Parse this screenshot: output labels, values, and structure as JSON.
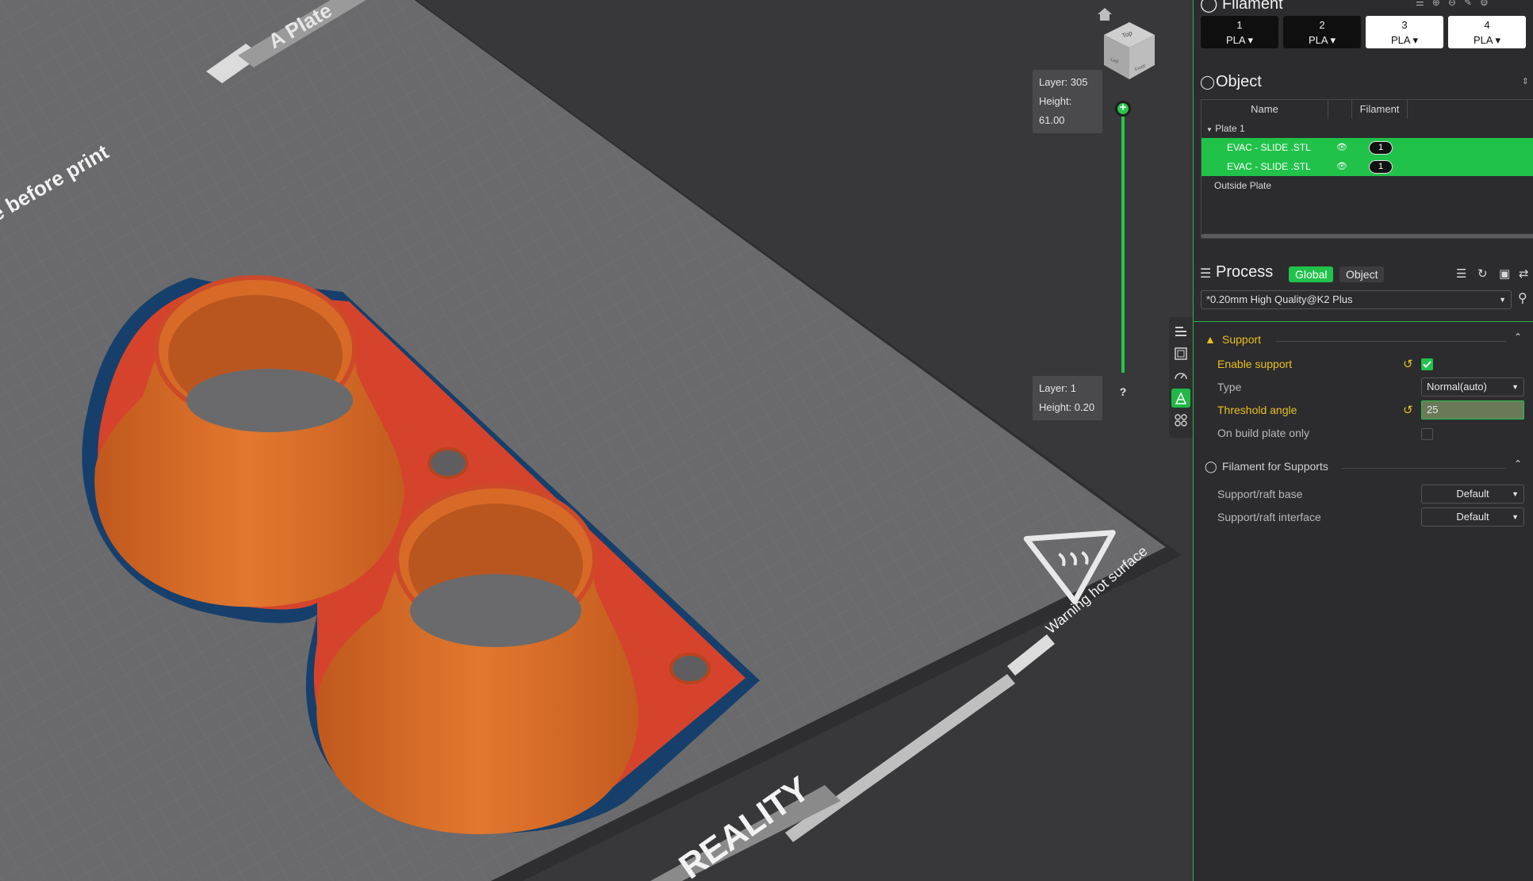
{
  "viewport": {
    "plate_label": "A Plate",
    "bed_text_left": "e before print",
    "bed_warning": "Warning hot surface",
    "bed_brand": "REALITY",
    "layer_top": {
      "layer": "Layer: 305",
      "height": "Height: 61.00"
    },
    "layer_bottom": {
      "layer": "Layer: 1",
      "height": "Height: 0.20"
    },
    "help": "?",
    "view_cube": {
      "top": "Top",
      "left": "Left",
      "front": "Front"
    }
  },
  "filament": {
    "title": "Filament",
    "slots": [
      {
        "num": "1",
        "type": "PLA"
      },
      {
        "num": "2",
        "type": "PLA"
      },
      {
        "num": "3",
        "type": "PLA"
      },
      {
        "num": "4",
        "type": "PLA"
      }
    ]
  },
  "object": {
    "title": "Object",
    "col_name": "Name",
    "col_filament": "Filament",
    "plate": "Plate 1",
    "items": [
      {
        "name": "EVAC - SLIDE .STL",
        "filament": "1"
      },
      {
        "name": "EVAC - SLIDE .STL",
        "filament": "1"
      }
    ],
    "outside": "Outside Plate"
  },
  "process": {
    "title": "Process",
    "global_label": "Global",
    "object_label": "Object",
    "preset": "*0.20mm High Quality@K2 Plus",
    "support_group": "Support",
    "enable_support": "Enable support",
    "type_label": "Type",
    "type_value": "Normal(auto)",
    "threshold_label": "Threshold angle",
    "threshold_value": "25",
    "build_plate_only": "On build plate only",
    "filament_support_group": "Filament for Supports",
    "raft_base_label": "Support/raft base",
    "raft_base_value": "Default",
    "raft_interface_label": "Support/raft interface",
    "raft_interface_value": "Default"
  },
  "colors": {
    "accent": "#21c24a",
    "changed": "#e8c020",
    "model": "#e0702a",
    "brim_blue": "#16406e"
  }
}
